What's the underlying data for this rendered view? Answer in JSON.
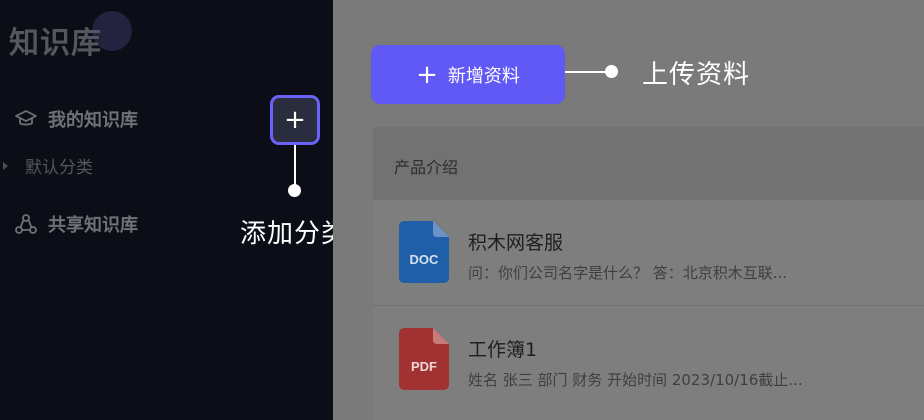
{
  "sidebar": {
    "title": "知识库",
    "my_kb": "我的知识库",
    "default_category": "默认分类",
    "shared_kb": "共享知识库"
  },
  "annotations": {
    "add_category_label": "添加分类",
    "add_category_symbol": "+",
    "upload_label": "上传资料"
  },
  "main": {
    "upload_button": {
      "symbol": "+",
      "label": "新增资料"
    },
    "section_title": "产品介绍",
    "files": [
      {
        "name": "积木网客服",
        "desc": "问：你们公司名字是什么？ 答：北京积木互联...",
        "type": "DOC",
        "color": "#1e5fa8"
      },
      {
        "name": "工作簿1",
        "desc": "姓名 张三 部门 财务 开始时间 2023/10/16截止...",
        "type": "PDF",
        "color": "#a03232"
      }
    ]
  },
  "colors": {
    "accent": "#6159f5",
    "highlight_border": "#6a63f8",
    "sidebar_bg": "#0b0e17"
  }
}
